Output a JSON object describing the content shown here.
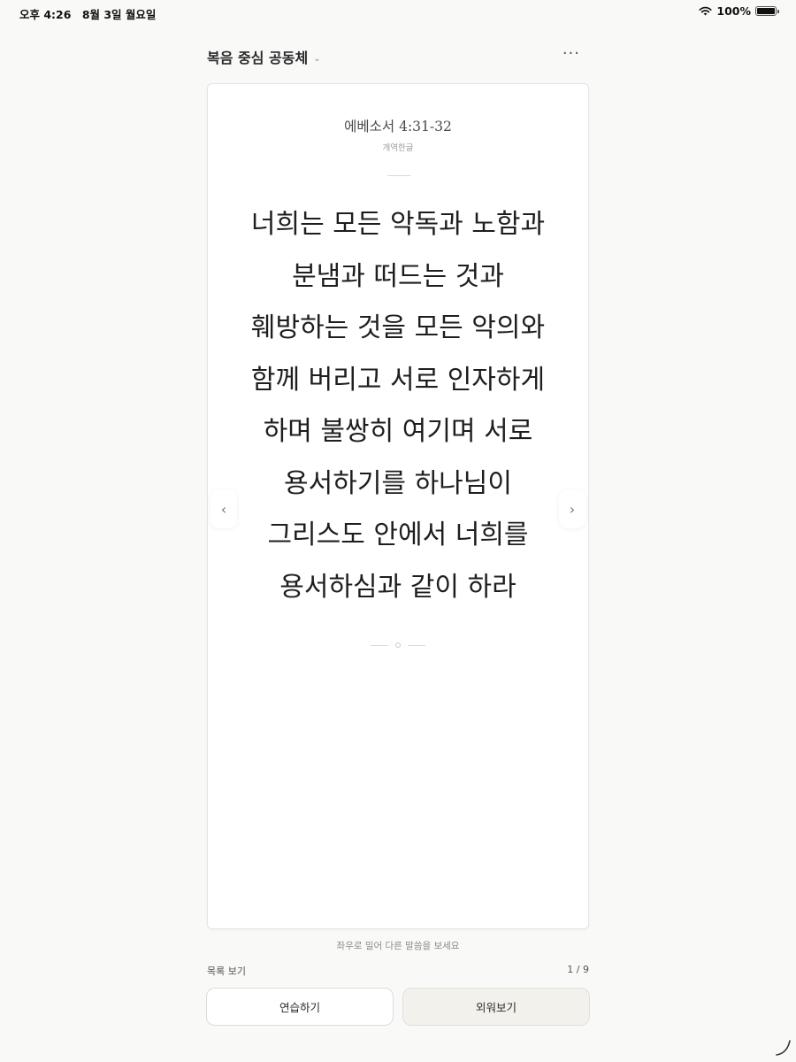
{
  "status_bar": {
    "time": "오후 4:26",
    "date": "8월 3일 월요일",
    "battery": "100%"
  },
  "header": {
    "group_title": "복음 중심 공동체",
    "more_symbol": "···"
  },
  "verse": {
    "reference": "에베소서 4:31-32",
    "version": "개역한글",
    "lines": [
      "너희는 모든 악독과 노함과",
      "분냄과 떠드는 것과",
      "훼방하는 것을 모든 악의와",
      "함께 버리고 서로 인자하게",
      "하며 불쌍히 여기며 서로",
      "용서하기를 하나님이",
      "그리스도 안에서 너희를",
      "용서하심과 같이 하라"
    ]
  },
  "navigation": {
    "prev_symbol": "‹",
    "next_symbol": "›"
  },
  "footer": {
    "swipe_hint": "좌우로 밀어 다른 말씀을 보세요",
    "list_link": "목록 보기",
    "page_counter": "1 / 9",
    "practice_button": "연습하기",
    "memorize_button": "외워보기"
  },
  "colors": {
    "background": "#f9f9f8",
    "card": "#ffffff",
    "memorize_button_bg": "#f3f1ec"
  }
}
